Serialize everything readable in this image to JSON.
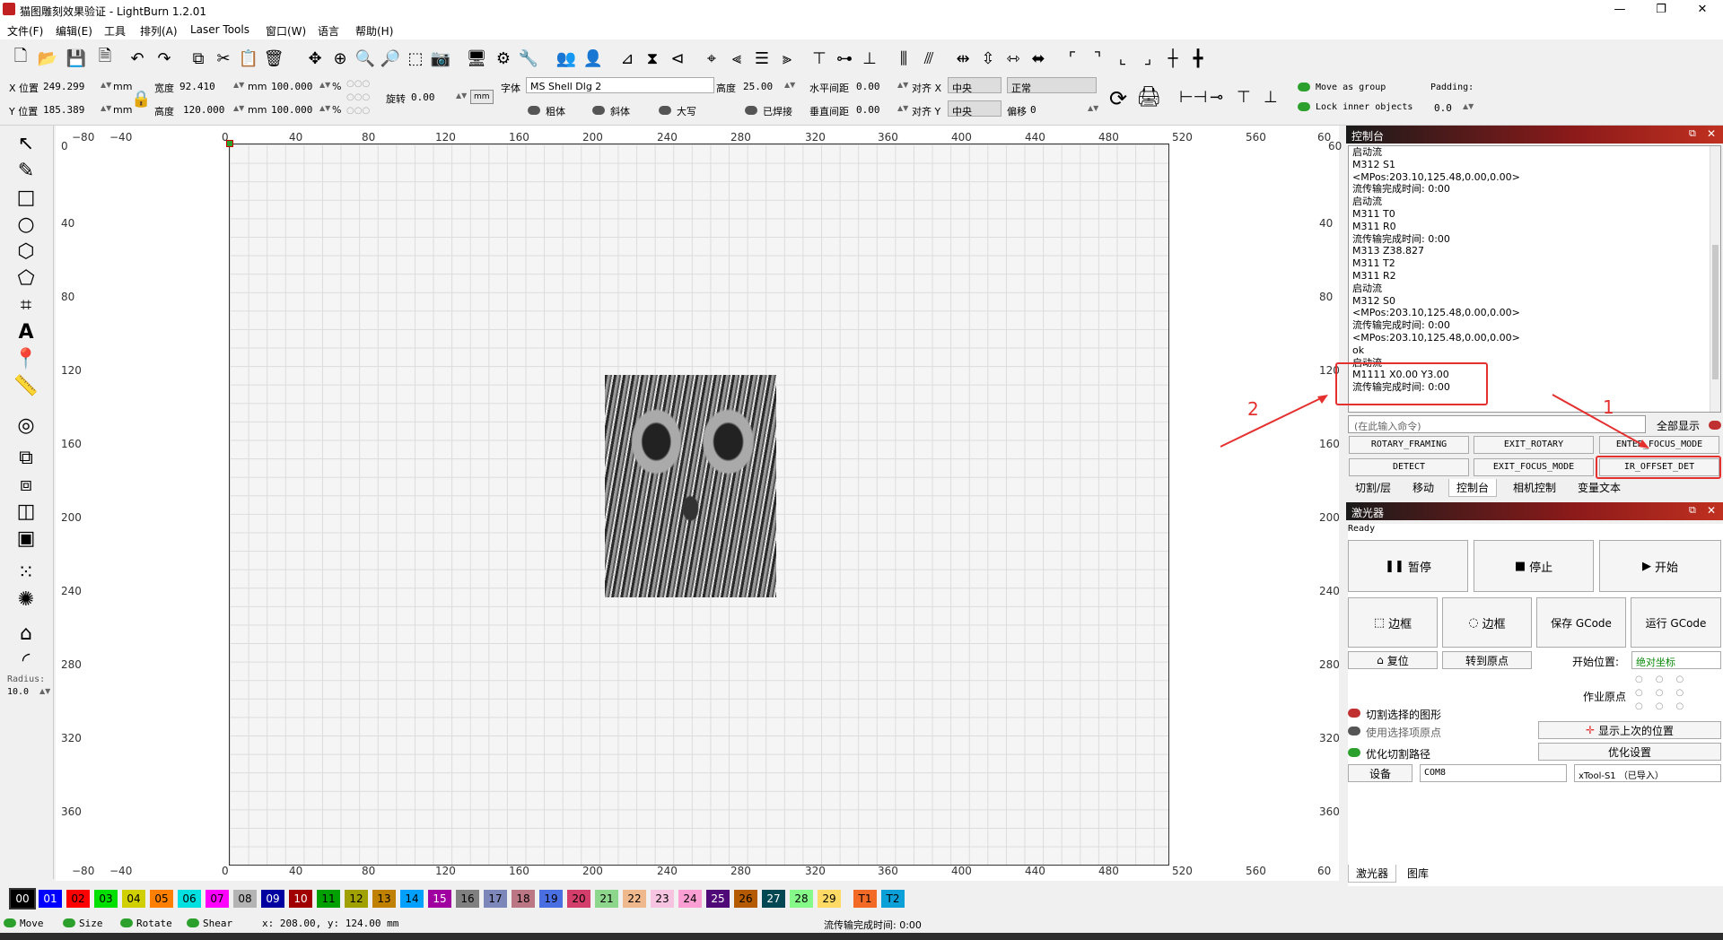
{
  "window": {
    "title": "猫图雕刻效果验证 - LightBurn 1.2.01",
    "min": "—",
    "max": "❐",
    "close": "✕"
  },
  "menu": [
    "文件(F)",
    "编辑(E)",
    "工具",
    "排列(A)",
    "Laser Tools",
    "窗口(W)",
    "语言",
    "帮助(H)"
  ],
  "props": {
    "x_label": "X 位置",
    "x_val": "249.299",
    "y_label": "Y 位置",
    "y_val": "185.389",
    "unit": "mm",
    "w_label": "宽度",
    "w_val": "92.410",
    "h_label": "高度",
    "h_val": "120.000",
    "pct1": "100.000",
    "pct2": "100.000",
    "pct": "%",
    "rot_label": "旋转",
    "rot_val": "0.00",
    "mm_btn": "mm",
    "font_label": "字体",
    "font_val": "MS Shell Dlg 2",
    "fh_label": "高度",
    "fh_val": "25.00",
    "hsp_label": "水平间距",
    "hsp_val": "0.00",
    "align_x": "对齐 X",
    "align_x_val": "中央",
    "normal": "正常",
    "bold": "粗体",
    "italic": "斜体",
    "caps": "大写",
    "welded": "已焊接",
    "vsp_label": "垂直间距",
    "vsp_val": "0.00",
    "align_y": "对齐 Y",
    "align_y_val": "中央",
    "offset_label": "偏移",
    "offset_val": "0",
    "move_group": "Move as group",
    "lock_inner": "Lock inner objects",
    "padding": "Padding:",
    "padding_val": "0.0"
  },
  "left": {
    "radius_label": "Radius:",
    "radius_val": "10.0"
  },
  "rulers": {
    "top": [
      "−80",
      "−40",
      "0",
      "40",
      "80",
      "120",
      "160",
      "200",
      "240",
      "280",
      "320",
      "360",
      "400",
      "440",
      "480",
      "520",
      "560",
      "60"
    ],
    "left": [
      "0",
      "40",
      "80",
      "120",
      "160",
      "200",
      "240",
      "280",
      "320",
      "360"
    ],
    "right": [
      "40",
      "80",
      "120",
      "160",
      "200",
      "240",
      "280",
      "320",
      "360"
    ],
    "right_top": "60"
  },
  "console": {
    "title": "控制台",
    "lines": [
      "启动流",
      "M312 S1",
      "<MPos:203.10,125.48,0.00,0.00>",
      "流传输完成时间: 0:00",
      "启动流",
      "M311 T0",
      "M311 R0",
      "流传输完成时间: 0:00",
      "M313 Z38.827",
      "M311 T2",
      "M311 R2",
      "启动流",
      "M312 S0",
      "<MPos:203.10,125.48,0.00,0.00>",
      "流传输完成时间: 0:00",
      "<MPos:203.10,125.48,0.00,0.00>",
      "ok",
      "启动流",
      "M1111 X0.00 Y3.00",
      "流传输完成时间: 0:00"
    ],
    "cmd_placeholder": "(在此输入命令)",
    "show_all": "全部显示",
    "macros": [
      "ROTARY_FRAMING",
      "EXIT_ROTARY",
      "ENTER_FOCUS_MODE",
      "DETECT",
      "EXIT_FOCUS_MODE",
      "IR_OFFSET_DET"
    ],
    "tabs": [
      "切割/层",
      "移动",
      "控制台",
      "相机控制",
      "变量文本"
    ]
  },
  "annotations": {
    "a1": "1",
    "a2": "2"
  },
  "laser": {
    "title": "激光器",
    "status": "Ready",
    "pause": "暂停",
    "stop": "停止",
    "start": "开始",
    "frame1": "边框",
    "frame2": "边框",
    "save_gcode": "保存 GCode",
    "run_gcode": "运行 GCode",
    "home": "复位",
    "goto_origin": "转到原点",
    "start_from": "开始位置:",
    "start_from_val": "绝对坐标",
    "job_origin": "作业原点",
    "cut_selected": "切割选择的图形",
    "use_sel_origin": "使用选择项原点",
    "optimize": "优化切割路径",
    "show_last": "显示上次的位置",
    "opt_settings": "优化设置",
    "device": "设备",
    "port": "COM8",
    "machine": "xTool-S1 （已导入）",
    "bottom_tabs": [
      "激光器",
      "图库"
    ]
  },
  "palette": [
    {
      "n": "00",
      "c": "#000000",
      "t": "#fff"
    },
    {
      "n": "01",
      "c": "#0000ff",
      "t": "#fff"
    },
    {
      "n": "02",
      "c": "#ff0000",
      "t": "#000"
    },
    {
      "n": "03",
      "c": "#00e000",
      "t": "#000"
    },
    {
      "n": "04",
      "c": "#d0d000",
      "t": "#000"
    },
    {
      "n": "05",
      "c": "#ff8000",
      "t": "#000"
    },
    {
      "n": "06",
      "c": "#00e0e0",
      "t": "#000"
    },
    {
      "n": "07",
      "c": "#ff00ff",
      "t": "#000"
    },
    {
      "n": "08",
      "c": "#b4b4b4",
      "t": "#000"
    },
    {
      "n": "09",
      "c": "#0000a0",
      "t": "#fff"
    },
    {
      "n": "10",
      "c": "#a00000",
      "t": "#fff"
    },
    {
      "n": "11",
      "c": "#00a000",
      "t": "#000"
    },
    {
      "n": "12",
      "c": "#a0a000",
      "t": "#000"
    },
    {
      "n": "13",
      "c": "#c08000",
      "t": "#000"
    },
    {
      "n": "14",
      "c": "#00a0ff",
      "t": "#000"
    },
    {
      "n": "15",
      "c": "#a000a0",
      "t": "#fff"
    },
    {
      "n": "16",
      "c": "#808080",
      "t": "#000"
    },
    {
      "n": "17",
      "c": "#7d87b9",
      "t": "#000"
    },
    {
      "n": "18",
      "c": "#bb7784",
      "t": "#000"
    },
    {
      "n": "19",
      "c": "#4a6fe3",
      "t": "#000"
    },
    {
      "n": "20",
      "c": "#d33f6a",
      "t": "#000"
    },
    {
      "n": "21",
      "c": "#8cd78c",
      "t": "#000"
    },
    {
      "n": "22",
      "c": "#f0b98d",
      "t": "#000"
    },
    {
      "n": "23",
      "c": "#f6c4e1",
      "t": "#000"
    },
    {
      "n": "24",
      "c": "#fa9ed4",
      "t": "#000"
    },
    {
      "n": "25",
      "c": "#500a78",
      "t": "#fff"
    },
    {
      "n": "26",
      "c": "#b45a00",
      "t": "#000"
    },
    {
      "n": "27",
      "c": "#004754",
      "t": "#fff"
    },
    {
      "n": "28",
      "c": "#86fa88",
      "t": "#000"
    },
    {
      "n": "29",
      "c": "#ffdb66",
      "t": "#000"
    },
    {
      "n": "T1",
      "c": "#f36926",
      "t": "#000"
    },
    {
      "n": "T2",
      "c": "#0ca0d9",
      "t": "#000"
    }
  ],
  "status": {
    "move": "Move",
    "size": "Size",
    "rotate": "Rotate",
    "shear": "Shear",
    "coords": "x: 208.00, y: 124.00 mm",
    "stream": "流传输完成时间: 0:00"
  }
}
